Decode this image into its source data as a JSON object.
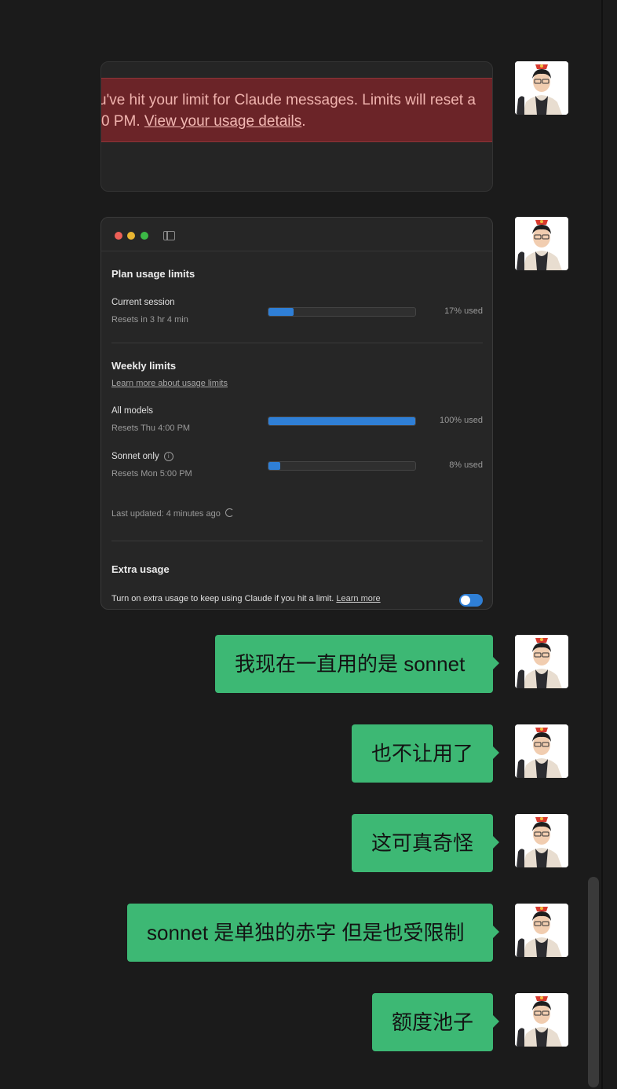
{
  "chat": {
    "limit_banner": {
      "line1": "u've hit your limit for Claude messages. Limits will reset a",
      "line2_prefix": "0 PM. ",
      "link": "View your usage details",
      "line2_suffix": "."
    },
    "usage_panel": {
      "plan_title": "Plan usage limits",
      "current_session": {
        "title": "Current session",
        "resets": "Resets in 3 hr 4 min",
        "percent": 17,
        "percent_label": "17% used"
      },
      "weekly_title": "Weekly limits",
      "weekly_learn": "Learn more about usage limits",
      "all_models": {
        "title": "All models",
        "resets": "Resets Thu 4:00 PM",
        "percent": 100,
        "percent_label": "100% used"
      },
      "sonnet_only": {
        "title": "Sonnet only",
        "resets": "Resets Mon 5:00 PM",
        "percent": 8,
        "percent_label": "8% used"
      },
      "info_glyph": "i",
      "last_updated": "Last updated: 4 minutes ago",
      "extra_title": "Extra usage",
      "extra_text": "Turn on extra usage to keep using Claude if you hit a limit.",
      "extra_learn": "Learn more",
      "extra_toggle_on": true
    },
    "messages": [
      {
        "text": "我现在一直用的是 sonnet"
      },
      {
        "text": "也不让用了"
      },
      {
        "text": "这可真奇怪"
      },
      {
        "text": "sonnet 是单独的赤字 但是也受限制"
      },
      {
        "text": "额度池子"
      }
    ]
  },
  "colors": {
    "background": "#1b1b1b",
    "bubble": "#3db874",
    "banner": "#6b2428",
    "progress": "#2f7fd6"
  },
  "icons": {
    "avatar": "user-avatar-cartoon-man",
    "window_controls": [
      "close",
      "minimize",
      "maximize"
    ],
    "sidebar": "sidebar-toggle-icon",
    "info": "info-icon",
    "refresh": "refresh-icon"
  }
}
